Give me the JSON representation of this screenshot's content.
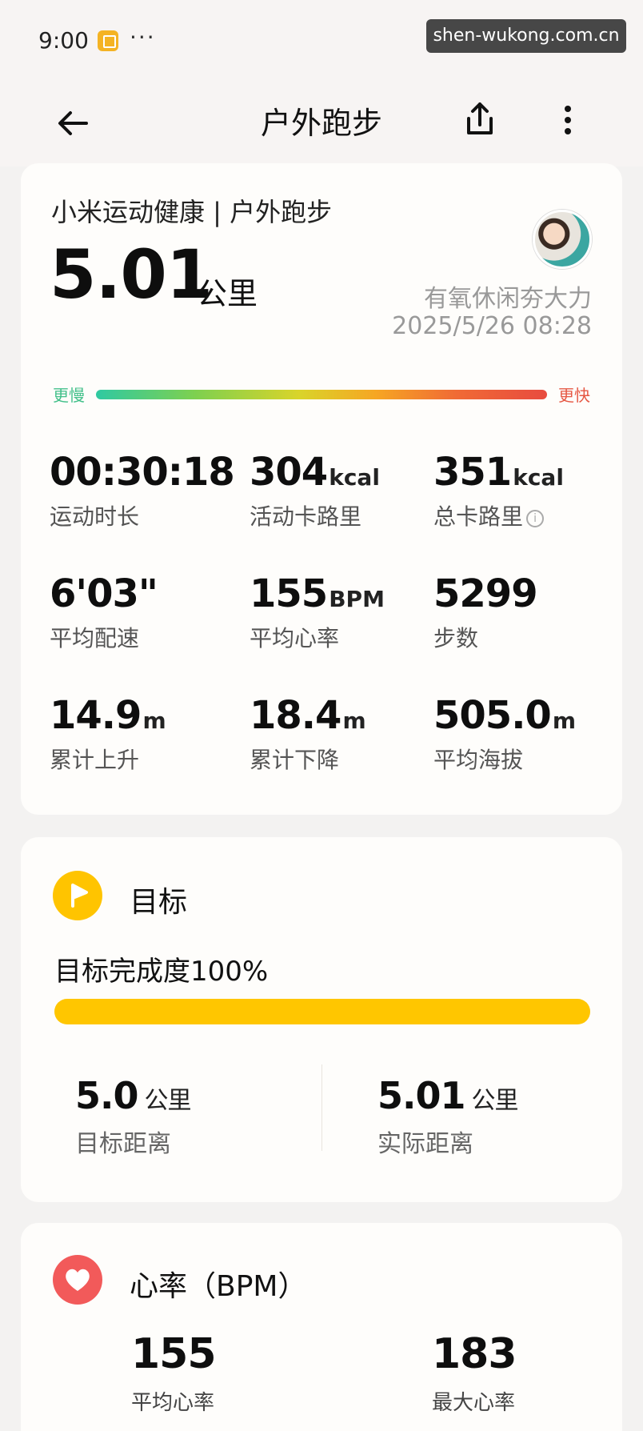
{
  "status_bar": {
    "time": "9:00",
    "dots": "···",
    "watermark": "shen-wukong.com.cn"
  },
  "header": {
    "title": "户外跑步"
  },
  "summary": {
    "source": "小米运动健康 | 户外跑步",
    "distance_value": "5.01",
    "distance_unit": "公里",
    "workout_type": "有氧休闲夯大力",
    "datetime": "2025/5/26 08:28",
    "pace_bar": {
      "slow_label": "更慢",
      "fast_label": "更快"
    },
    "stats": [
      {
        "value": "00:30:18",
        "unit": "",
        "label": "运动时长"
      },
      {
        "value": "304",
        "unit": "kcal",
        "label": "活动卡路里"
      },
      {
        "value": "351",
        "unit": "kcal",
        "label": "总卡路里",
        "info": "i"
      },
      {
        "value": "6'03\"",
        "unit": "",
        "label": "平均配速"
      },
      {
        "value": "155",
        "unit": "BPM",
        "label": "平均心率"
      },
      {
        "value": "5299",
        "unit": "",
        "label": "步数"
      },
      {
        "value": "14.9",
        "unit": "m",
        "label": "累计上升"
      },
      {
        "value": "18.4",
        "unit": "m",
        "label": "累计下降"
      },
      {
        "value": "505.0",
        "unit": "m",
        "label": "平均海拔"
      }
    ]
  },
  "goal": {
    "title": "目标",
    "progress_text": "目标完成度100%",
    "progress_fraction": 1.0,
    "target": {
      "value": "5.0",
      "unit": "公里",
      "label": "目标距离"
    },
    "actual": {
      "value": "5.01",
      "unit": "公里",
      "label": "实际距离"
    }
  },
  "heart_rate": {
    "title": "心率（BPM）",
    "avg": {
      "value": "155",
      "label": "平均心率"
    },
    "max": {
      "value": "183",
      "label": "最大心率"
    }
  },
  "colors": {
    "goal_accent": "#ffc400",
    "heart_accent": "#f25a5a",
    "pace_slow": "#42c08a",
    "pace_fast": "#e65844"
  },
  "icons": [
    "back-arrow-icon",
    "share-icon",
    "more-vertical-icon",
    "notification-icon",
    "avatar",
    "flag-play-icon",
    "heart-icon",
    "info-icon"
  ]
}
